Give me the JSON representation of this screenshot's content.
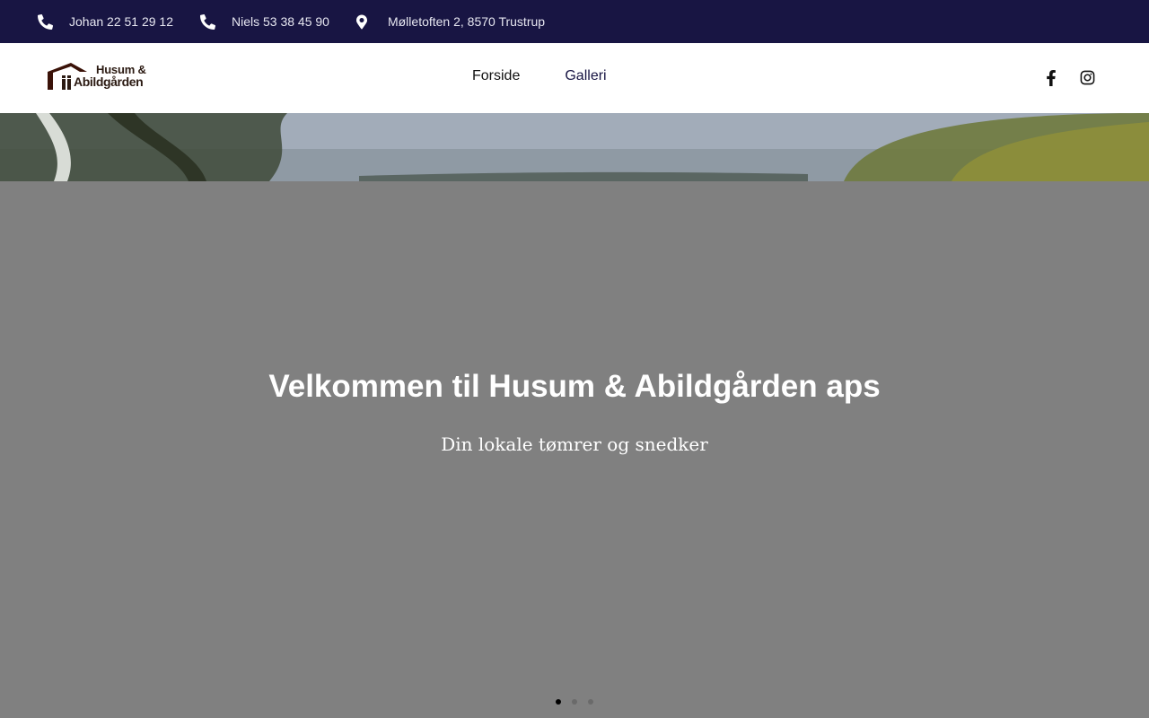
{
  "topbar": {
    "contacts": [
      {
        "icon": "phone-icon",
        "text": "Johan 22 51 29 12"
      },
      {
        "icon": "phone-icon",
        "text": "Niels 53 38 45 90"
      },
      {
        "icon": "map-pin-icon",
        "text": "Mølletoften 2, 8570 Trustrup"
      }
    ],
    "background": "#181543"
  },
  "header": {
    "logo": {
      "line1": "Husum &",
      "line2": "Abildgården"
    },
    "nav": [
      {
        "label": "Forside"
      },
      {
        "label": "Galleri"
      }
    ],
    "social": [
      {
        "icon": "facebook-icon"
      },
      {
        "icon": "instagram-icon"
      }
    ]
  },
  "hero": {
    "title": "Velkommen til Husum & Abildgården aps",
    "subtitle": "Din lokale tømrer og snedker",
    "slides": {
      "count": 3,
      "active": 0
    }
  }
}
